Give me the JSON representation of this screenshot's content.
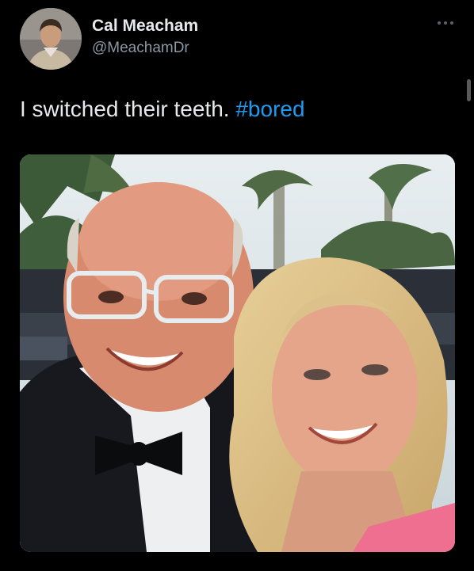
{
  "tweet": {
    "author": {
      "display_name": "Cal Meacham",
      "handle": "@MeachamDr",
      "avatar_icon": "user-avatar-icon"
    },
    "more_icon": "more-horizontal-icon",
    "text": "I switched their teeth. ",
    "hashtag": "#bored",
    "media_icon": "photo-icon"
  },
  "colors": {
    "background": "#000000",
    "primary_text": "#e7e9ea",
    "secondary_text": "#8b98a5",
    "link": "#1d9bf0"
  }
}
